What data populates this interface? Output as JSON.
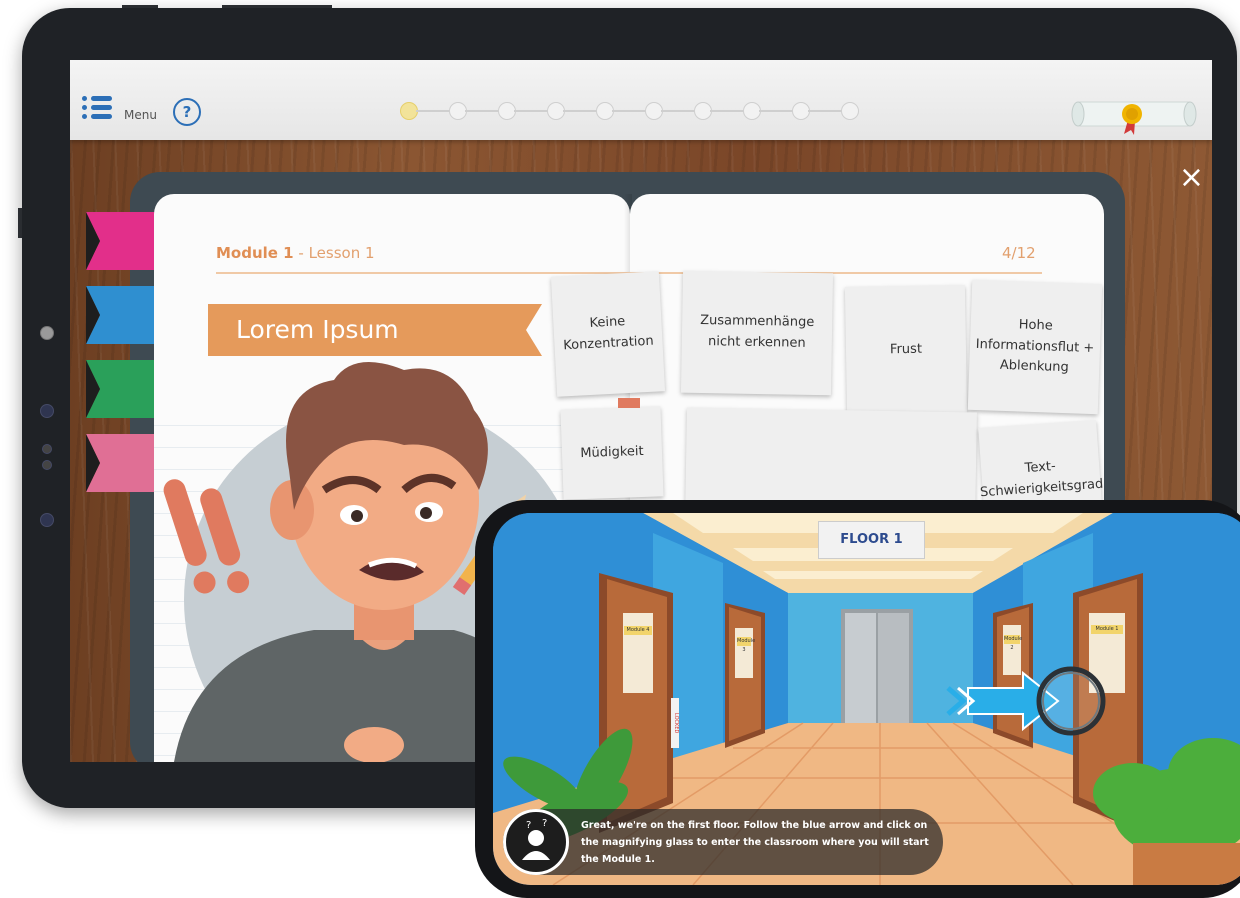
{
  "tablet": {
    "header": {
      "menu_label": "Menu",
      "help_symbol": "?",
      "progress": {
        "total": 10,
        "current": 1
      },
      "certificate_icon": "diploma-scroll-icon"
    },
    "close_symbol": "×",
    "book": {
      "module_label": "Module 1",
      "lesson_label": " - Lesson 1",
      "page_count": "4/12",
      "banner_title": "Lorem Ipsum",
      "tab_colors": [
        "#e22f8a",
        "#2f8fd0",
        "#2aa05a",
        "#e06f95"
      ],
      "notes": [
        "Keine Konzentration",
        "Zusammenhänge nicht erkennen",
        "Frust",
        "Hohe Informationsflut + Ablenkung",
        "Müdigkeit",
        "",
        "Text-Schwierigkeitsgrad"
      ]
    }
  },
  "phone": {
    "floor_sign": "FLOOR 1",
    "door_labels": [
      "Module 4",
      "Module 3",
      "Module 2",
      "Module 1"
    ],
    "locked_label": "LOCKED",
    "caption": "Great, we're on the first floor. Follow the blue arrow and click on the magnifying glass to enter the classroom where you will start the Module 1."
  }
}
